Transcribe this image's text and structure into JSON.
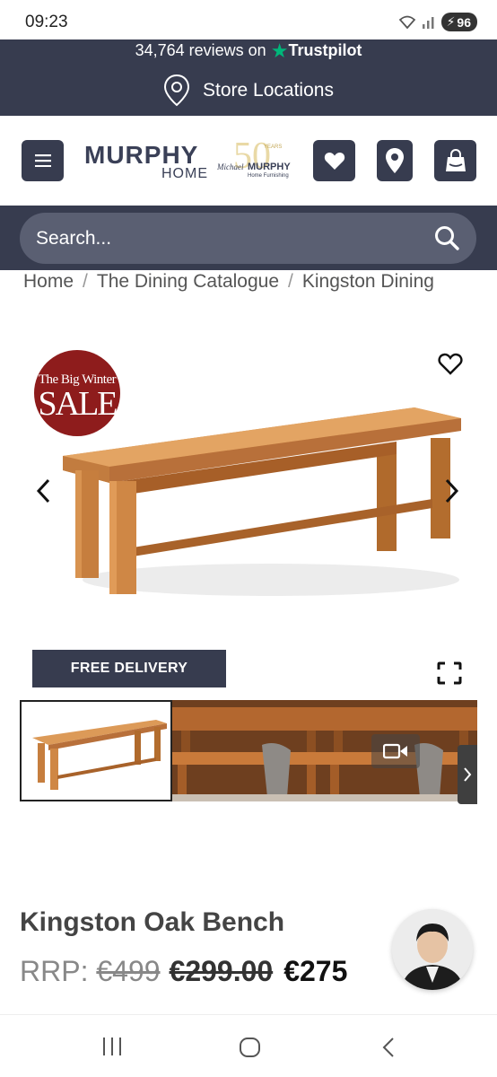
{
  "status_bar": {
    "time": "09:23",
    "battery": "96"
  },
  "banner": {
    "reviews_count": "34,764",
    "reviews_text": "reviews on",
    "trustpilot": "Trustpilot",
    "store_locations": "Store Locations"
  },
  "header": {
    "logo_main": "MURPHY",
    "logo_sub": "HOME",
    "logo_50": "50",
    "logo_years": "YEARS",
    "logo_michael": "Michael",
    "logo_murphy": "MURPHY",
    "logo_tagline": "Home Furnishing"
  },
  "search": {
    "placeholder": "Search..."
  },
  "breadcrumb": {
    "items": [
      "Home",
      "The Dining Catalogue",
      "Kingston Dining"
    ],
    "separator": "/"
  },
  "gallery": {
    "sale_badge_top": "The Big Winter",
    "sale_badge_main": "SALE",
    "free_delivery": "FREE DELIVERY"
  },
  "product": {
    "title": "Kingston Oak Bench",
    "rrp_label": "RRP:",
    "rrp_value": "€499",
    "was_price": "€299.00",
    "now_price": "€275"
  },
  "colors": {
    "navy": "#373c4f",
    "trustpilot_green": "#00b67a",
    "sale_red": "#8e1c1c",
    "oak": "#c9803f"
  }
}
